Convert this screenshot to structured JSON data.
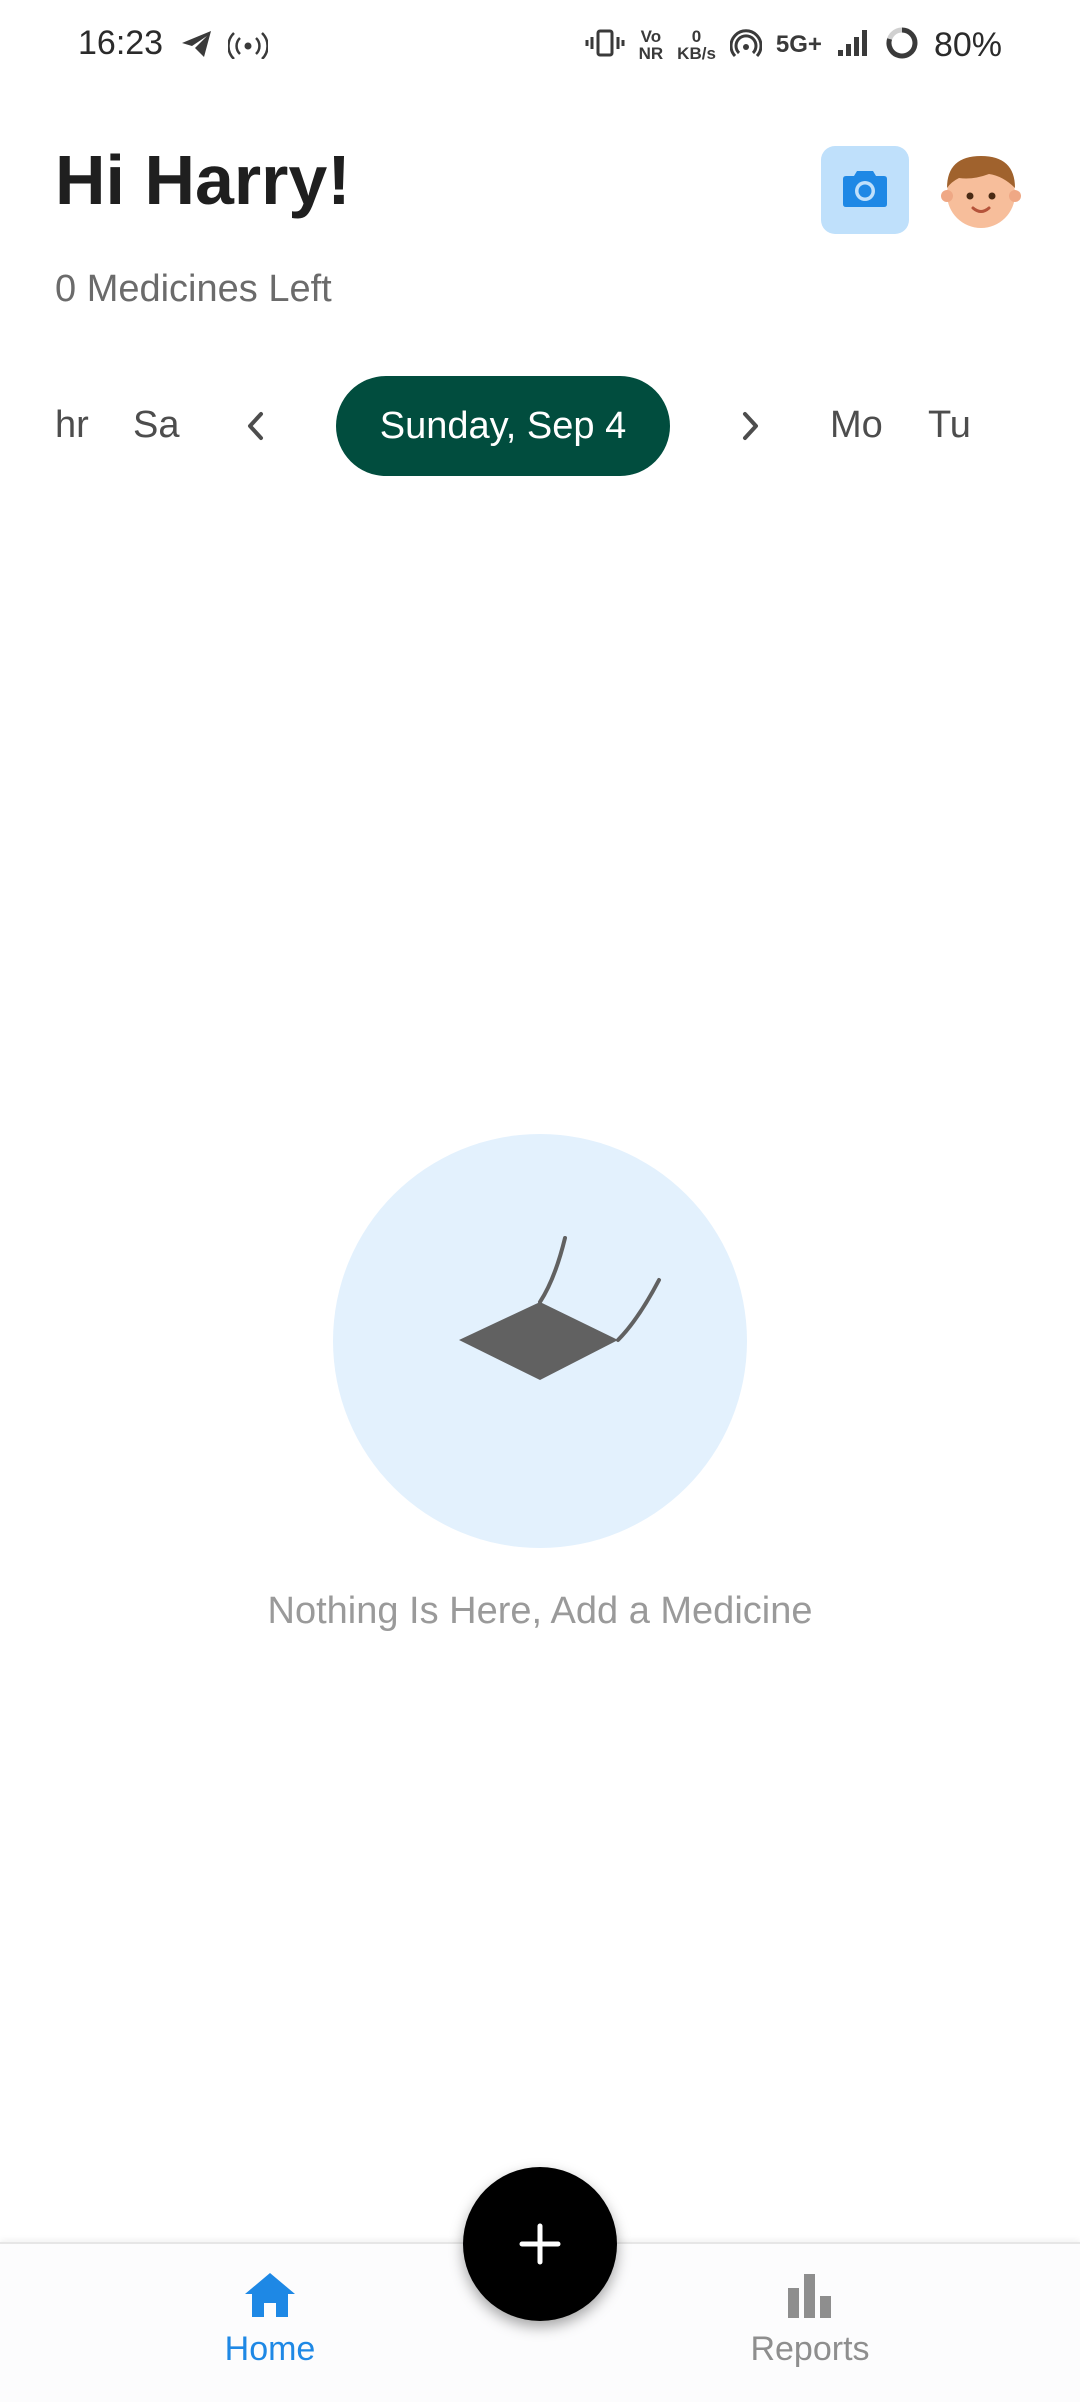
{
  "status_bar": {
    "time": "16:23",
    "volte": "Vo\nNR",
    "net_speed_value": "0",
    "net_speed_unit": "KB/s",
    "network": "5G+",
    "battery": "80%"
  },
  "header": {
    "greeting": "Hi Harry!",
    "subtitle": "0 Medicines Left"
  },
  "date_strip": {
    "prev_days": [
      "hr",
      "Sa"
    ],
    "selected_date": "Sunday, Sep 4",
    "next_days": [
      "Mo",
      "Tu"
    ]
  },
  "empty_state": {
    "message": "Nothing Is Here, Add a Medicine"
  },
  "bottom_nav": {
    "items": [
      {
        "label": "Home",
        "icon": "home-icon",
        "active": true
      },
      {
        "label": "Reports",
        "icon": "bar-chart-icon",
        "active": false
      }
    ],
    "fab_icon": "plus-icon"
  },
  "colors": {
    "accent": "#1e88e5",
    "date_pill": "#014d3e",
    "camera_bg": "#bfe0fb",
    "empty_circle": "#e3f1fd",
    "inactive_nav": "#8e8e8e"
  }
}
